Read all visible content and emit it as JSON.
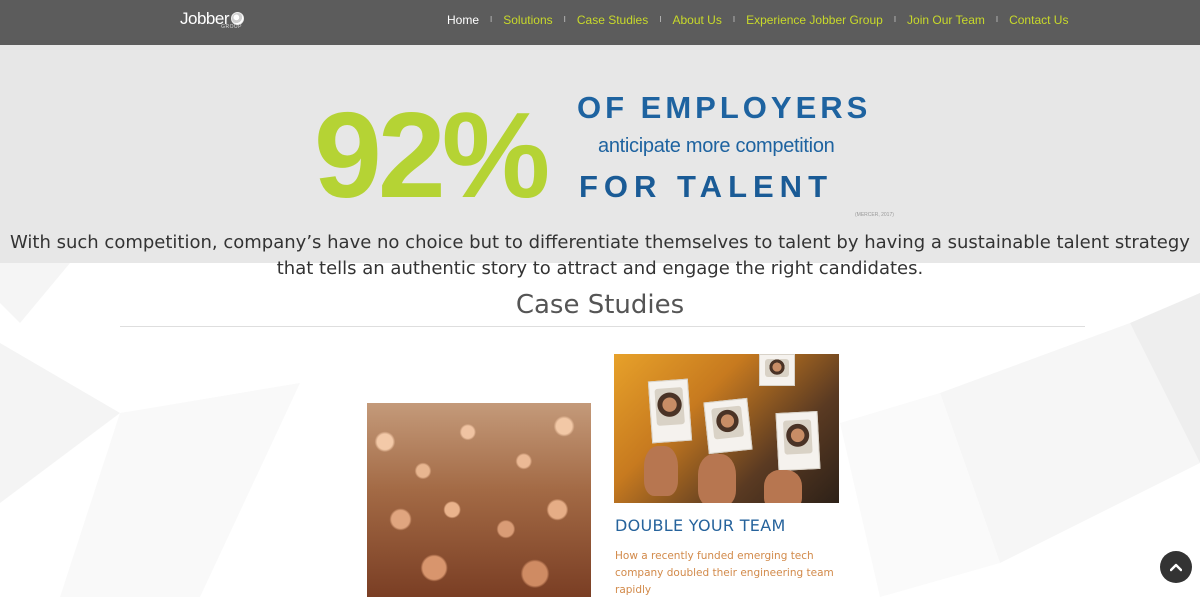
{
  "header": {
    "logo": {
      "text": "Jobber",
      "sub": "GROUP"
    },
    "nav": [
      {
        "label": "Home",
        "active": true
      },
      {
        "label": "Solutions",
        "active": false
      },
      {
        "label": "Case Studies",
        "active": false
      },
      {
        "label": "About Us",
        "active": false
      },
      {
        "label": "Experience Jobber Group",
        "active": false
      },
      {
        "label": "Join Our Team",
        "active": false
      },
      {
        "label": "Contact Us",
        "active": false
      }
    ],
    "nav_separator": "I"
  },
  "banner": {
    "stat_value": "92%",
    "line1": "OF EMPLOYERS",
    "line2": "anticipate more competition",
    "line3": "FOR TALENT",
    "source": "(MERCER, 2017)",
    "paragraph_line1": "With such competition, company’s have no choice but to differentiate themselves to talent by having a sustainable talent strategy",
    "paragraph_line2": "that tells an authentic story to attract and engage the right candidates."
  },
  "case_studies": {
    "title": "Case Studies",
    "items": [
      {
        "image_subject": "crowd of people",
        "title": "",
        "description": ""
      },
      {
        "image_subject": "hands holding photo portraits",
        "title": "DOUBLE YOUR TEAM",
        "description": "How a recently funded emerging tech company doubled their engineering team rapidly"
      }
    ]
  },
  "scroll_top": {
    "icon": "chevron-up-icon"
  },
  "colors": {
    "nav_bg": "#5c5c5c",
    "nav_link": "#c8d92a",
    "accent_green": "#b5d334",
    "accent_blue": "#1e63a0",
    "banner_bg": "#e7e7e7",
    "case_desc": "#d28a4a"
  }
}
